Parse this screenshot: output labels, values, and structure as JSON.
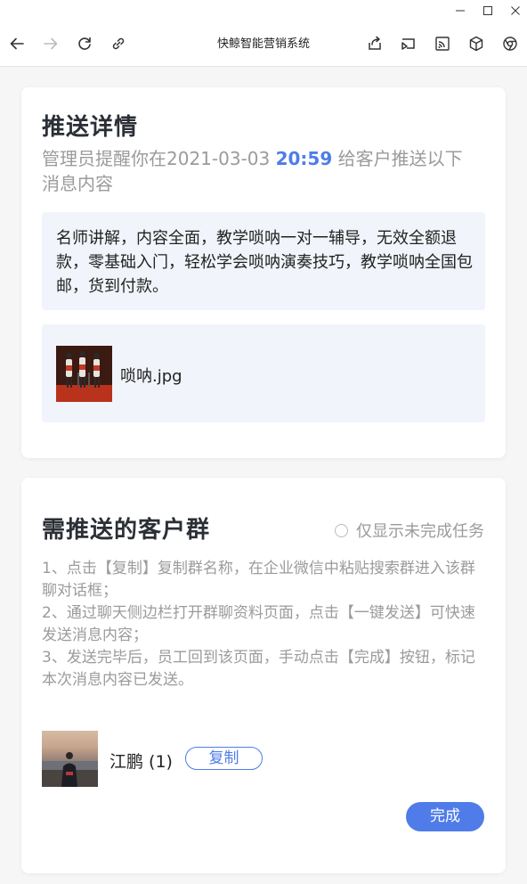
{
  "window": {
    "controls": [
      "minimize-icon",
      "maximize-icon",
      "close-icon"
    ]
  },
  "browser": {
    "title": "快鲸智能营销系统",
    "left_icons": [
      "back-arrow-icon",
      "forward-arrow-icon",
      "refresh-icon",
      "link-icon"
    ],
    "right_icons": [
      "share-icon",
      "cast-icon",
      "rss-icon",
      "cube-icon",
      "chrome-icon"
    ]
  },
  "push_detail": {
    "heading": "推送详情",
    "reminder_prefix": "管理员提醒你在2021-03-03 ",
    "reminder_time": "20:59",
    "reminder_suffix": " 给客户推送以下消息内容",
    "message": "名师讲解，内容全面，教学唢呐一对一辅导，无效全额退款，零基础入门，轻松学会唢呐演奏技巧，教学唢呐全国包邮，货到付款。",
    "attachment": {
      "filename": "唢呐.jpg"
    }
  },
  "groups": {
    "heading": "需推送的客户群",
    "filter_label": "仅显示未完成任务",
    "steps": [
      "1、点击【复制】复制群名称，在企业微信中粘贴搜索群进入该群聊对话框；",
      "2、通过聊天侧边栏打开群聊资料页面，点击【一键发送】可快速发送消息内容；",
      "3、发送完毕后，员工回到该页面，手动点击【完成】按钮，标记本次消息内容已发送。"
    ],
    "items": [
      {
        "name": "江鹏 (1)",
        "copy_label": "复制"
      }
    ],
    "done_label": "完成"
  },
  "colors": {
    "accent": "#4f7ce8",
    "box_bg": "#f1f4fa",
    "muted_text": "#9b9b9b"
  }
}
